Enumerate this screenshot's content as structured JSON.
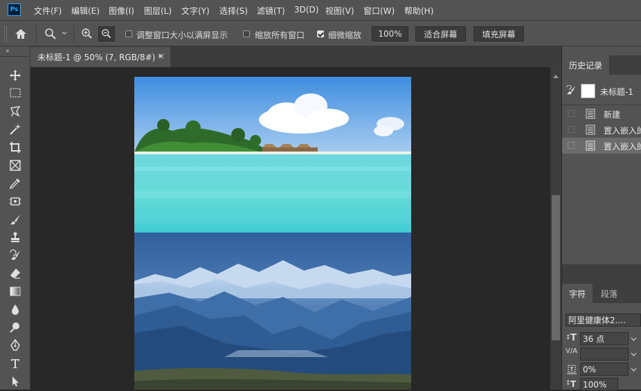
{
  "app": {
    "logo": "Ps"
  },
  "menu": [
    "文件(F)",
    "编辑(E)",
    "图像(I)",
    "图层(L)",
    "文字(Y)",
    "选择(S)",
    "滤镜(T)",
    "3D(D)",
    "视图(V)",
    "窗口(W)",
    "帮助(H)"
  ],
  "options": {
    "resize_windows_label": "调整窗口大小以满屏显示",
    "resize_windows_checked": false,
    "zoom_all_label": "缩放所有窗口",
    "zoom_all_checked": false,
    "scrubby_zoom_label": "细微缩放",
    "scrubby_zoom_checked": true,
    "zoom_value": "100%",
    "fit_screen_label": "适合屏幕",
    "fill_screen_label": "填充屏幕"
  },
  "document": {
    "tab_title": "未标题-1 @ 50% (7, RGB/8#) *",
    "close_glyph": "×"
  },
  "history": {
    "tab_label": "历史记录",
    "snapshot_label": "未标题-1",
    "items": [
      "新建",
      "置入嵌入的",
      "置入嵌入的"
    ]
  },
  "character": {
    "tab_label": "字符",
    "paragraph_tab_label": "段落",
    "font_family": "阿里健康体2....",
    "font_size": "36 点",
    "tracking": "0%",
    "vertical_scale": "100%",
    "size_icon_label": "T",
    "kerning_icon_label": "V/A"
  },
  "colors": {
    "chrome": "#535353",
    "canvas_bg": "#282828",
    "ps_blue": "#31a8ff"
  }
}
